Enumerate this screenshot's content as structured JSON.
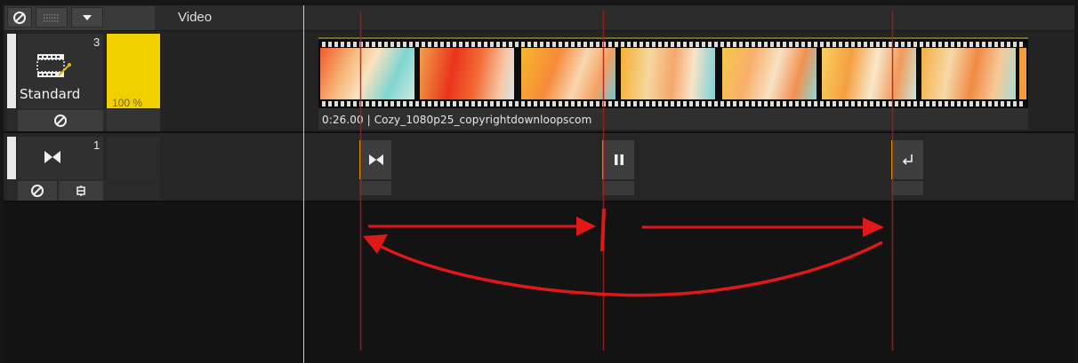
{
  "header": {
    "track_label": "Video"
  },
  "tracks": [
    {
      "number": "3",
      "mode": "Standard",
      "opacity": "100 %",
      "clip": {
        "info": "0:26.00 | Cozy_1080p25_copyrightdownloopscom"
      }
    },
    {
      "number": "1"
    }
  ],
  "markers": [
    {
      "type": "start-icon"
    },
    {
      "type": "pause-icon"
    },
    {
      "type": "return-icon"
    }
  ],
  "colors": {
    "opacity_yellow": "#f2d000",
    "marker_orange": "#e2a600",
    "annotation_red": "#e01818",
    "playhead": "#d8d08a"
  },
  "icons": {
    "mute": "mute-icon",
    "dots": "grid-dots-icon",
    "dropdown": "chevron-down-icon",
    "film": "film-icon",
    "transition": "bowtie-icon",
    "trim": "trim-icon"
  }
}
